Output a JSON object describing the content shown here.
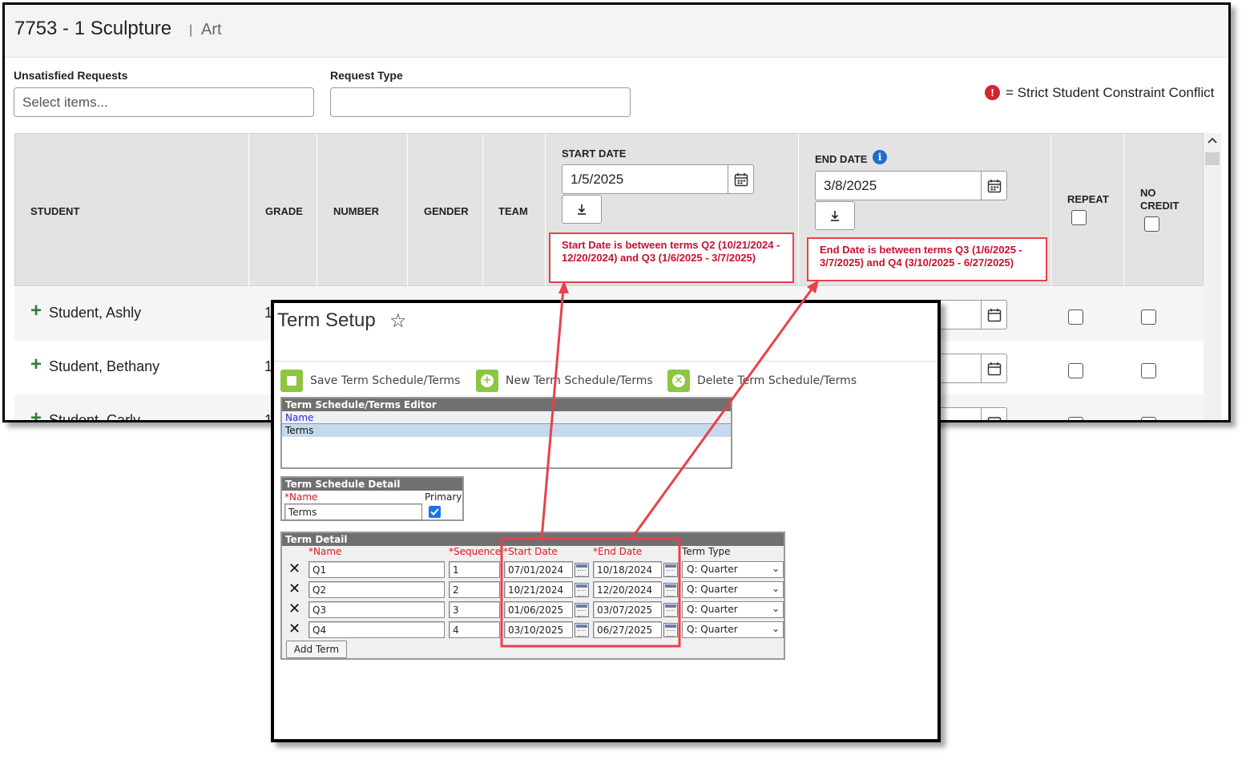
{
  "main": {
    "title": "7753 - 1 Sculpture",
    "separator": "|",
    "subtitle": "Art",
    "filters": {
      "unsatisfied_label": "Unsatisfied Requests",
      "unsatisfied_placeholder": "Select items...",
      "request_type_label": "Request Type",
      "request_type_value": ""
    },
    "legend": {
      "icon": "!",
      "text": "= Strict Student Constraint Conflict",
      "color": "#d0262d"
    },
    "columns": {
      "student": "STUDENT",
      "grade": "GRADE",
      "number": "NUMBER",
      "gender": "GENDER",
      "team": "TEAM",
      "start_date": "START DATE",
      "end_date": "END DATE",
      "repeat": "REPEAT",
      "no_credit_line1": "NO",
      "no_credit_line2": "CREDIT"
    },
    "start_date_value": "1/5/2025",
    "end_date_value": "3/8/2025",
    "start_error": "Start Date is between terms Q2 (10/21/2024 - 12/20/2024) and Q3 (1/6/2025 - 3/7/2025)",
    "end_error": "End Date is between terms Q3 (1/6/2025 - 3/7/2025) and Q4 (3/10/2025 - 6/27/2025)",
    "students": [
      {
        "name": "Student, Ashly",
        "grade": "1"
      },
      {
        "name": "Student, Bethany",
        "grade": "1"
      },
      {
        "name": "Student, Carly",
        "grade": "1"
      }
    ],
    "error_color": "#e8414b"
  },
  "term_setup": {
    "title": "Term Setup",
    "star_icon": "☆",
    "toolbar": {
      "save": "Save Term Schedule/Terms",
      "new": "New Term Schedule/Terms",
      "delete": "Delete Term Schedule/Terms"
    },
    "editor": {
      "header": "Term Schedule/Terms Editor",
      "name_col": "Name",
      "selected_item": "Terms"
    },
    "detail": {
      "header": "Term Schedule Detail",
      "name_label": "*Name",
      "primary_label": "Primary",
      "name_value": "Terms",
      "primary_checked": true
    },
    "term_detail": {
      "header": "Term Detail",
      "col_name": "*Name",
      "col_sequence": "*Sequence",
      "col_start": "*Start Date",
      "col_end": "*End Date",
      "col_type": "Term Type",
      "terms": [
        {
          "name": "Q1",
          "seq": "1",
          "start": "07/01/2024",
          "end": "10/18/2024",
          "type": "Q: Quarter"
        },
        {
          "name": "Q2",
          "seq": "2",
          "start": "10/21/2024",
          "end": "12/20/2024",
          "type": "Q: Quarter"
        },
        {
          "name": "Q3",
          "seq": "3",
          "start": "01/06/2025",
          "end": "03/07/2025",
          "type": "Q: Quarter"
        },
        {
          "name": "Q4",
          "seq": "4",
          "start": "03/10/2025",
          "end": "06/27/2025",
          "type": "Q: Quarter"
        }
      ],
      "add_button": "Add Term"
    }
  }
}
